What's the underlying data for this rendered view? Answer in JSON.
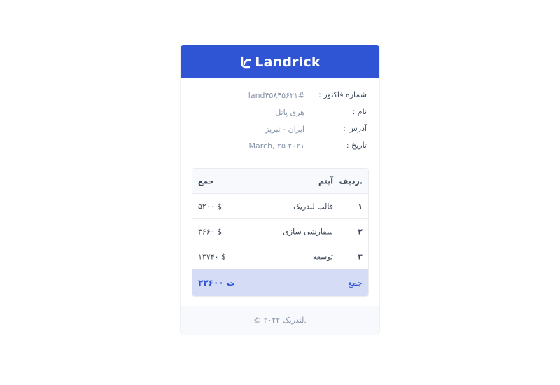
{
  "header": {
    "brand_name": "Landrick",
    "brand_color": "#2f55d4",
    "logo_icon": "landrick-logo-icon"
  },
  "invoice": {
    "number_label": "شماره فاکتور :",
    "number_value": "land۴۵۸۴۵۶۲۱#",
    "name_label": "نام :",
    "name_value": "هری پاتل",
    "address_label": "آدرس :",
    "address_value": "ایران - تبریز",
    "date_label": "تاریخ :",
    "date_value": "March, ۲۵ ۲۰۲۱"
  },
  "table": {
    "headers": {
      "index": "ردیف.",
      "item": "آیتم",
      "sum": "جمع"
    },
    "rows": [
      {
        "index": "۱",
        "item": "قالب لندریک",
        "sum": "۵۲۰۰ $"
      },
      {
        "index": "۲",
        "item": "سفارشی سازی",
        "sum": "۳۶۶۰ $"
      },
      {
        "index": "۳",
        "item": "توسعه",
        "sum": "۱۳۷۴۰ $"
      }
    ],
    "total_label": "جمع",
    "total_value": "۲۲۶۰۰ ت",
    "total_bg": "#d5dcf6"
  },
  "footer": {
    "copyright": "© ۲۰۲۲ لندریک."
  }
}
